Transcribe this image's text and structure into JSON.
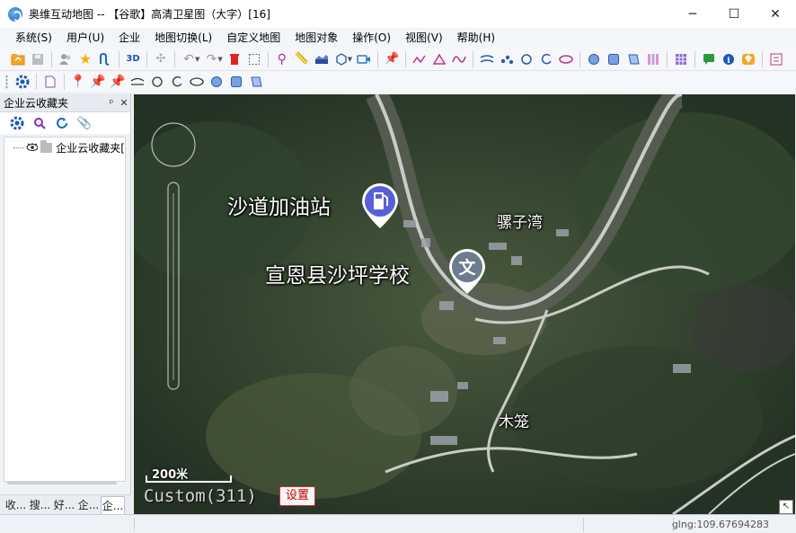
{
  "window": {
    "title": "奥维互动地图 -- 【谷歌】高清卫星图（大字）[16]",
    "minimize": "─",
    "maximize": "☐",
    "close": "✕"
  },
  "menu": [
    "系统(S)",
    "用户(U)",
    "企业",
    "地图切换(L)",
    "自定义地图",
    "地图对象",
    "操作(O)",
    "视图(V)",
    "帮助(H)"
  ],
  "toolbar1": [
    "folder-open",
    "save",
    "users",
    "star",
    "route",
    "3d",
    "split",
    "undo",
    "redo",
    "delete",
    "select-rect",
    "pin-user",
    "ruler",
    "level",
    "hexagon",
    "camera",
    "pushpin",
    "polyline",
    "triangle",
    "curve",
    "parallel",
    "dots",
    "circle",
    "arc",
    "ellipse",
    "filled-circle",
    "filled-square",
    "tag",
    "stripes",
    "grid",
    "comment",
    "info",
    "gem",
    "more"
  ],
  "toolbar2": [
    "settings",
    "document",
    "pin-yellow",
    "pin-blue",
    "pin-green",
    "line",
    "circle",
    "arc",
    "ellipse",
    "dot-circle",
    "square",
    "flag"
  ],
  "left_panel": {
    "title": "企业云收藏夹",
    "pin_btn": "ᵖ",
    "close_btn": "✕",
    "tree_item": "企业云收藏夹[",
    "tabs": [
      "收...",
      "搜...",
      "好...",
      "企...",
      "企..."
    ],
    "active_tab_index": 4
  },
  "map": {
    "pois": [
      {
        "label": "沙道加油站",
        "icon": "gas-station",
        "color": "#5a5fd8"
      },
      {
        "label": "宣恩县沙坪学校",
        "icon": "文",
        "color": "#6b7c8e"
      }
    ],
    "place_labels": [
      "骡子湾",
      "木笼"
    ],
    "scale_label": "200米",
    "layer_label": "Custom(311)",
    "settings_button": "设置",
    "corner_button": "↖"
  },
  "status": {
    "coordinate": "glng:109.67694283"
  }
}
